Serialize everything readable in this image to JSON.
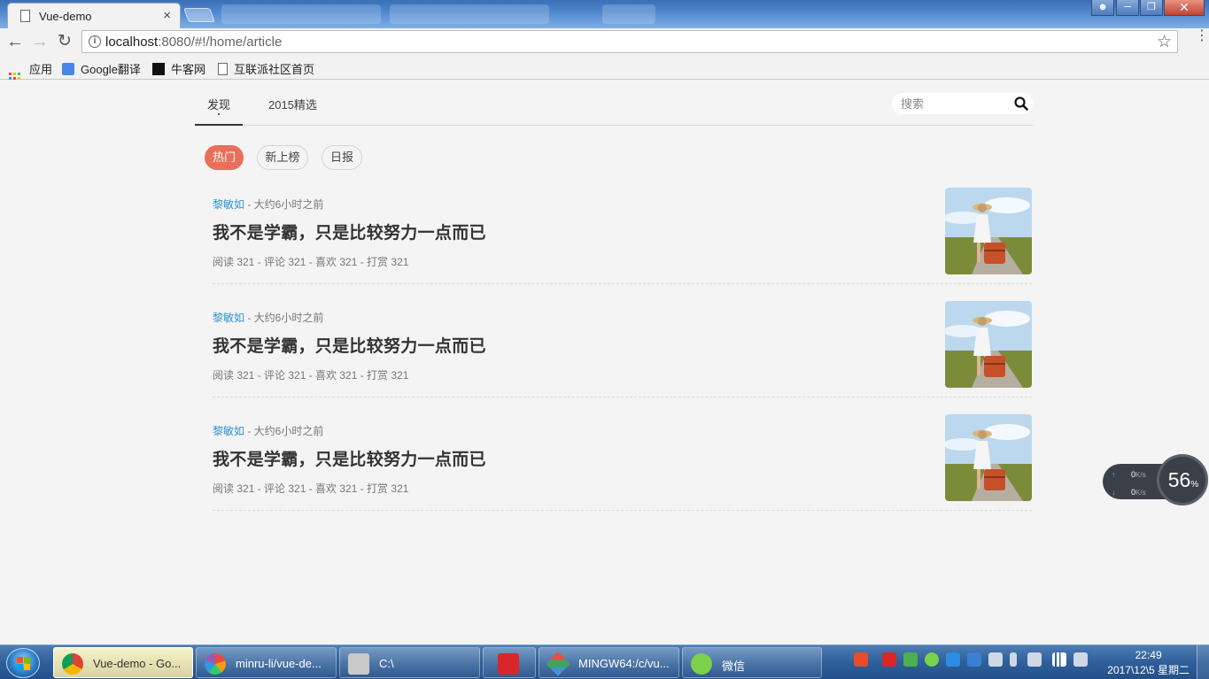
{
  "browser": {
    "tab_title": "Vue-demo",
    "tab_close": "×",
    "url_host": "localhost",
    "url_rest": ":8080/#!/home/article",
    "bookmarks": [
      {
        "label": "应用"
      },
      {
        "label": "Google翻译"
      },
      {
        "label": "牛客网"
      },
      {
        "label": "互联派社区首页"
      }
    ]
  },
  "nav": {
    "tabs": [
      {
        "label": "发现"
      },
      {
        "label": "2015精选"
      }
    ],
    "search_placeholder": "搜索"
  },
  "filters": [
    {
      "label": "热门",
      "active": true
    },
    {
      "label": "新上榜",
      "active": false
    },
    {
      "label": "日报",
      "active": false
    }
  ],
  "articles": [
    {
      "author": "黎敏如",
      "time": " - 大约6小时之前",
      "title": "我不是学霸，只是比较努力一点而已",
      "stats": "阅读 321 - 评论 321 - 喜欢 321 - 打赏 321"
    },
    {
      "author": "黎敏如",
      "time": " - 大约6小时之前",
      "title": "我不是学霸，只是比较努力一点而已",
      "stats": "阅读 321 - 评论 321 - 喜欢 321 - 打赏 321"
    },
    {
      "author": "黎敏如",
      "time": " - 大约6小时之前",
      "title": "我不是学霸，只是比较努力一点而已",
      "stats": "阅读 321 - 评论 321 - 喜欢 321 - 打赏 321"
    }
  ],
  "net_widget": {
    "up": "0",
    "down": "0",
    "unit": "K/s",
    "percent": "56",
    "percent_sign": "%"
  },
  "taskbar": {
    "items": [
      {
        "label": "Vue-demo - Go..."
      },
      {
        "label": "minru-li/vue-de..."
      },
      {
        "label": "C:\\"
      },
      {
        "label": ""
      },
      {
        "label": "MINGW64:/c/vu..."
      },
      {
        "label": "微信"
      }
    ],
    "time": "22:49",
    "date": "2017\\12\\5 星期二"
  },
  "colors": {
    "accent": "#ea6f5a",
    "author_link": "#3194d0"
  }
}
